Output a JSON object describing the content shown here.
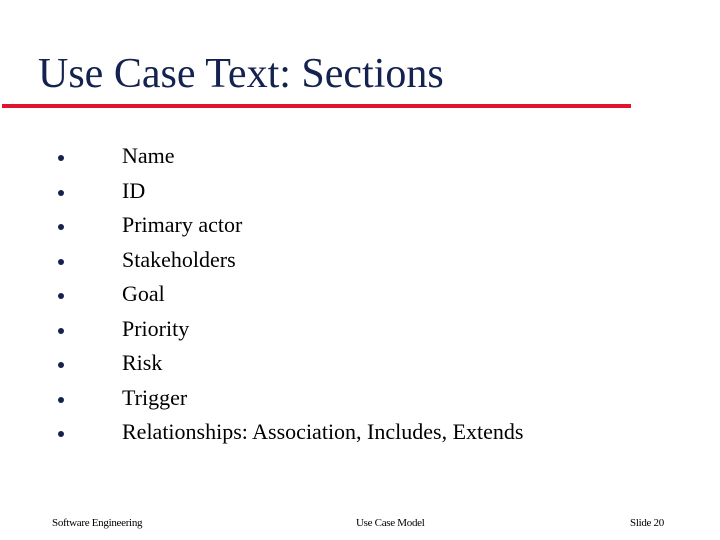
{
  "slide": {
    "title": "Use Case Text: Sections",
    "bullets": [
      "Name",
      "ID",
      "Primary actor",
      "Stakeholders",
      "Goal",
      "Priority",
      "Risk",
      "Trigger",
      "Relationships: Association, Includes, Extends"
    ]
  },
  "footer": {
    "left": "Software Engineering",
    "center": "Use Case Model",
    "right": "Slide  20"
  },
  "colors": {
    "title": "#14224f",
    "rule": "#e0142f",
    "bullet": "#14224f"
  }
}
